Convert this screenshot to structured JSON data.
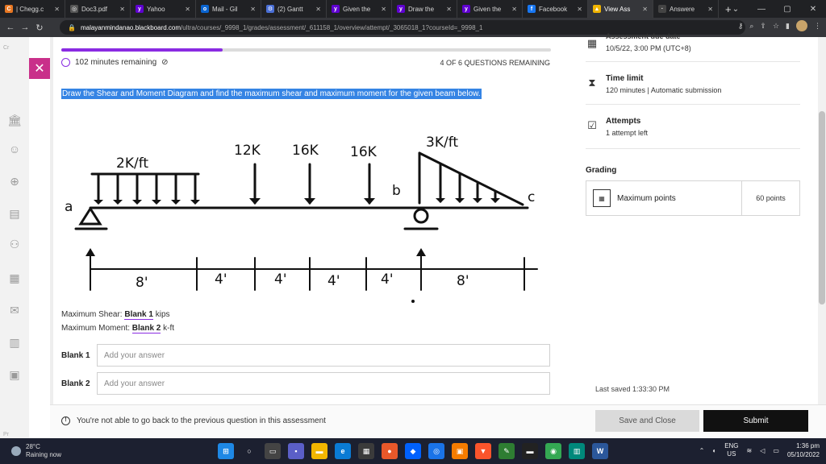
{
  "browser": {
    "tabs": [
      {
        "label": "| Chegg.c",
        "fav_letter": "C",
        "fav_color": "#e87722",
        "active": false
      },
      {
        "label": "Doc3.pdf",
        "fav_letter": "◎",
        "fav_color": "#555555",
        "active": false
      },
      {
        "label": "Yahoo",
        "fav_letter": "y",
        "fav_color": "#5f01d1",
        "active": false
      },
      {
        "label": "Mail - Gil",
        "fav_letter": "o",
        "fav_color": "#0a64d0",
        "active": false
      },
      {
        "label": "(2) Gantt",
        "fav_letter": "⚙",
        "fav_color": "#4a6fd6",
        "active": false
      },
      {
        "label": "Given the",
        "fav_letter": "y",
        "fav_color": "#5f01d1",
        "active": false
      },
      {
        "label": "Draw the",
        "fav_letter": "y",
        "fav_color": "#5f01d1",
        "active": false
      },
      {
        "label": "Given the",
        "fav_letter": "y",
        "fav_color": "#5f01d1",
        "active": false
      },
      {
        "label": "Facebook",
        "fav_letter": "f",
        "fav_color": "#1877f2",
        "active": false
      },
      {
        "label": "View Ass",
        "fav_letter": "▲",
        "fav_color": "#f0b400",
        "active": true
      },
      {
        "label": "Answere",
        "fav_letter": "·",
        "fav_color": "#444444",
        "active": false
      }
    ],
    "url_host": "malayanmindanao.blackboard.com",
    "url_path": "/ultra/courses/_9998_1/grades/assessment/_611158_1/overview/attempt/_3065018_1?courseId=_9998_1"
  },
  "rail": {
    "top_label": "Cr",
    "bottom_label": "Pr"
  },
  "assessment": {
    "time_remaining": "102 minutes remaining",
    "questions_remaining": "4 OF 6 QUESTIONS REMAINING",
    "progress_fraction": 0.33,
    "question_text": "Draw the Shear and Moment Diagram and find the maximum shear and maximum moment for the given beam below.",
    "max_shear_label": "Maximum Shear:",
    "max_shear_blank": "Blank 1",
    "max_shear_unit": "kips",
    "max_moment_label": "Maximum Moment:",
    "max_moment_blank": "Blank 2",
    "max_moment_unit": "k-ft",
    "blank1_label": "Blank 1",
    "blank2_label": "Blank 2",
    "placeholder": "Add your answer",
    "no_back_notice": "You're not able to go back to the previous question in this assessment",
    "save_label": "Save and Close",
    "submit_label": "Submit"
  },
  "diagram": {
    "udl_left": "2K/ft",
    "point1": "12K",
    "point2": "16K",
    "point3": "16K",
    "triangular": "3K/ft",
    "label_a": "a",
    "label_b": "b",
    "label_c": "c",
    "dim1": "8'",
    "dim2": "4'",
    "dim3": "4'",
    "dim4": "4'",
    "dim5": "4'",
    "dim6": "8'"
  },
  "panel": {
    "due_heading": "Assessment due date",
    "due_date": "10/5/22, 3:00 PM (UTC+8)",
    "time_limit_heading": "Time limit",
    "time_limit_value": "120 minutes | Automatic submission",
    "attempts_heading": "Attempts",
    "attempts_value": "1 attempt left",
    "grading_heading": "Grading",
    "max_points_label": "Maximum points",
    "max_points_value": "60 points",
    "last_saved": "Last saved 1:33:30 PM"
  },
  "taskbar": {
    "temp": "28°C",
    "weather": "Raining now",
    "lang1": "ENG",
    "lang2": "US",
    "time": "1:36 pm",
    "date": "05/10/2022"
  }
}
